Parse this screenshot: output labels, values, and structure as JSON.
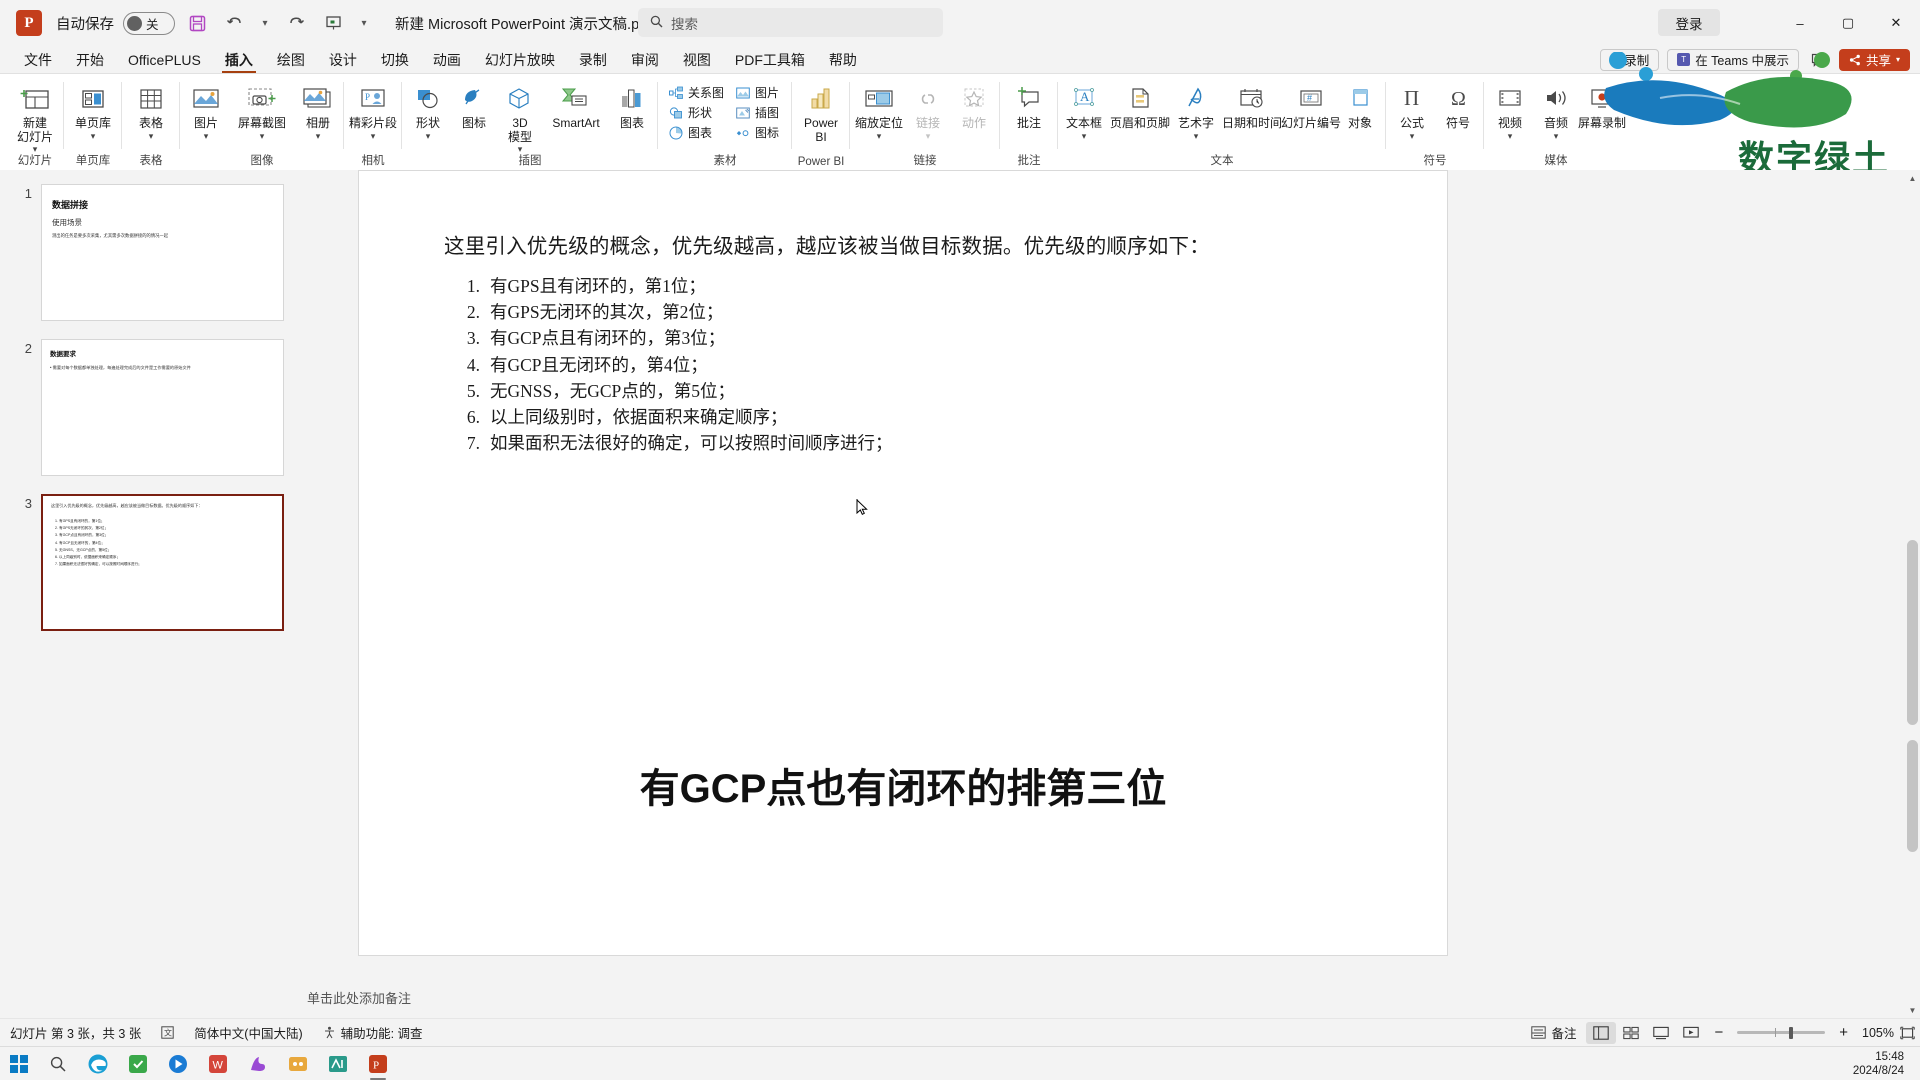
{
  "titlebar": {
    "app_icon": "powerpoint-icon",
    "autosave_label": "自动保存",
    "autosave_state": "关",
    "save_icon": "save-icon",
    "undo_icon": "undo-icon",
    "redo_icon": "redo-icon",
    "present_icon": "present-icon",
    "customize_icon": "customize-quick-access-icon",
    "doc_title": "新建 Microsoft PowerPoint 演示文稿.pptx",
    "search_placeholder": "搜索",
    "login_label": "登录",
    "minimize": "–",
    "maximize": "▢",
    "close": "✕"
  },
  "tabs": [
    {
      "label": "文件",
      "active": false
    },
    {
      "label": "开始",
      "active": false
    },
    {
      "label": "OfficePLUS",
      "active": false
    },
    {
      "label": "插入",
      "active": true
    },
    {
      "label": "绘图",
      "active": false
    },
    {
      "label": "设计",
      "active": false
    },
    {
      "label": "切换",
      "active": false
    },
    {
      "label": "动画",
      "active": false
    },
    {
      "label": "幻灯片放映",
      "active": false
    },
    {
      "label": "录制",
      "active": false
    },
    {
      "label": "审阅",
      "active": false
    },
    {
      "label": "视图",
      "active": false
    },
    {
      "label": "PDF工具箱",
      "active": false
    },
    {
      "label": "帮助",
      "active": false
    }
  ],
  "tab_right": {
    "record_label": "录制",
    "teams_label": "在 Teams 中展示",
    "comment_icon": "comment-icon",
    "share_label": "共享",
    "share_color": "#c43e1c"
  },
  "ribbon": {
    "groups": [
      {
        "label": "幻灯片",
        "buttons": [
          {
            "name": "new-slide",
            "label": "新建\n幻灯片",
            "caret": true,
            "icon": "new-slide-icon"
          }
        ]
      },
      {
        "label": "单页库",
        "buttons": [
          {
            "name": "page-library",
            "label": "单页库",
            "caret": true,
            "icon": "page-library-icon"
          }
        ]
      },
      {
        "label": "表格",
        "buttons": [
          {
            "name": "table",
            "label": "表格",
            "caret": true,
            "icon": "table-icon"
          }
        ]
      },
      {
        "label": "图像",
        "buttons": [
          {
            "name": "pictures",
            "label": "图片",
            "caret": true,
            "icon": "picture-icon"
          },
          {
            "name": "screenshot",
            "label": "屏幕截图",
            "caret": true,
            "icon": "screenshot-icon"
          },
          {
            "name": "photo-album",
            "label": "相册",
            "caret": true,
            "icon": "photo-album-icon"
          }
        ]
      },
      {
        "label": "相机",
        "buttons": [
          {
            "name": "highlight-clip",
            "label": "精彩片段",
            "caret": true,
            "icon": "highlight-clip-icon"
          }
        ]
      },
      {
        "label": "插图",
        "buttons": [
          {
            "name": "shapes",
            "label": "形状",
            "caret": true,
            "icon": "shapes-icon"
          },
          {
            "name": "icons",
            "label": "图标",
            "caret": false,
            "icon": "icons-icon"
          },
          {
            "name": "model-3d",
            "label": "3D 模型",
            "caret": true,
            "icon": "model-3d-icon"
          },
          {
            "name": "smartart",
            "label": "SmartArt",
            "caret": false,
            "icon": "smartart-icon"
          },
          {
            "name": "chart",
            "label": "图表",
            "caret": false,
            "icon": "chart-icon"
          }
        ]
      },
      {
        "label": "素材",
        "items": [
          {
            "name": "relation-chart",
            "label": "关系图",
            "icon": "relation-chart-icon"
          },
          {
            "name": "material-picture",
            "label": "图片",
            "icon": "material-picture-icon"
          },
          {
            "name": "material-shape",
            "label": "形状",
            "icon": "material-shape-icon"
          },
          {
            "name": "illustration",
            "label": "插图",
            "icon": "illustration-icon"
          },
          {
            "name": "material-chart",
            "label": "图表",
            "icon": "material-chart-icon"
          },
          {
            "name": "material-icon",
            "label": "图标",
            "icon": "material-icon-icon"
          }
        ]
      },
      {
        "label": "Power BI",
        "buttons": [
          {
            "name": "power-bi",
            "label": "Power\nBI",
            "caret": false,
            "icon": "power-bi-icon"
          }
        ]
      },
      {
        "label": "链接",
        "buttons": [
          {
            "name": "zoom-locate",
            "label": "缩放定位",
            "caret": true,
            "icon": "zoom-locate-icon"
          },
          {
            "name": "link",
            "label": "链接",
            "caret": true,
            "icon": "link-icon",
            "disabled": true
          },
          {
            "name": "action",
            "label": "动作",
            "caret": false,
            "icon": "action-icon",
            "disabled": true
          }
        ]
      },
      {
        "label": "批注",
        "buttons": [
          {
            "name": "new-comment",
            "label": "批注",
            "caret": false,
            "icon": "comment-plus-icon"
          }
        ]
      },
      {
        "label": "文本",
        "buttons": [
          {
            "name": "text-box",
            "label": "文本框",
            "caret": true,
            "icon": "text-box-icon"
          },
          {
            "name": "header-footer",
            "label": "页眉和页脚",
            "caret": false,
            "icon": "header-footer-icon"
          },
          {
            "name": "wordart",
            "label": "艺术字",
            "caret": true,
            "icon": "wordart-icon"
          },
          {
            "name": "date-time",
            "label": "日期和时间",
            "caret": false,
            "icon": "date-time-icon"
          },
          {
            "name": "slide-number",
            "label": "幻灯片编号",
            "caret": false,
            "icon": "slide-number-icon"
          },
          {
            "name": "object",
            "label": "对象",
            "caret": false,
            "icon": "object-icon"
          }
        ]
      },
      {
        "label": "符号",
        "buttons": [
          {
            "name": "equation",
            "label": "公式",
            "caret": true,
            "icon": "equation-icon"
          },
          {
            "name": "symbol",
            "label": "符号",
            "caret": false,
            "icon": "symbol-icon"
          }
        ]
      },
      {
        "label": "媒体",
        "buttons": [
          {
            "name": "video",
            "label": "视频",
            "caret": true,
            "icon": "video-icon"
          },
          {
            "name": "audio",
            "label": "音频",
            "caret": true,
            "icon": "audio-icon"
          },
          {
            "name": "screen-record",
            "label": "屏幕录制",
            "caret": false,
            "icon": "screen-record-icon"
          }
        ]
      }
    ]
  },
  "slide_panel": {
    "thumbs": [
      {
        "number": "1",
        "selected": false,
        "title": "数据拼接",
        "subtitle": "使用场景",
        "body": "测出的任务是要多次采集，尤其需多次数据拼接的的情况一起"
      },
      {
        "number": "2",
        "selected": false,
        "title": "数据要求",
        "subtitle": "",
        "body": "• 需要对每个数据都单独处理，每遍处理完成后的文件是工作需要的原始文件"
      },
      {
        "number": "3",
        "selected": true,
        "title": "",
        "subtitle": "",
        "body": "这里引入优先级的概念，优先级越高，越应该被当做目标数据。优先级的顺序如下："
      }
    ]
  },
  "slide": {
    "intro": "这里引入优先级的概念，优先级越高，越应该被当做目标数据。优先级的顺序如下：",
    "list": [
      {
        "num": "1.",
        "text": "有GPS且有闭环的，第1位；"
      },
      {
        "num": "2.",
        "text": "有GPS无闭环的其次，第2位；"
      },
      {
        "num": "3.",
        "text": "有GCP点且有闭环的，第3位；"
      },
      {
        "num": "4.",
        "text": "有GCP且无闭环的，第4位；"
      },
      {
        "num": "5.",
        "text": "无GNSS，无GCP点的，第5位；"
      },
      {
        "num": "6.",
        "text": "以上同级别时，依据面积来确定顺序；"
      },
      {
        "num": "7.",
        "text": "如果面积无法很好的确定，可以按照时间顺序进行；"
      }
    ],
    "caption": "有GCP点也有闭环的排第三位"
  },
  "notes": {
    "placeholder": "单击此处添加备注"
  },
  "statusbar": {
    "slide_count": "幻灯片 第 3 张，共 3 张",
    "accessibility_icon": "accessibility-icon",
    "language": "简体中文(中国大陆)",
    "accessibility_label": "辅助功能: 调查",
    "notes_label": "备注",
    "view_normal": "normal-view-icon",
    "view_sorter": "slide-sorter-icon",
    "view_reading": "reading-view-icon",
    "view_show": "slideshow-icon",
    "zoom_out": "−",
    "zoom_in": "+",
    "zoom_value": "105%",
    "fit_icon": "fit-slide-icon"
  },
  "taskbar": {
    "start_icon": "windows-start-icon",
    "search_icon": "taskbar-search-icon",
    "apps": [
      {
        "name": "edge-icon",
        "active": false
      },
      {
        "name": "app-green-icon",
        "active": false
      },
      {
        "name": "app-blue-play-icon",
        "active": false
      },
      {
        "name": "wps-icon",
        "active": false
      },
      {
        "name": "app-purple-icon",
        "active": false
      },
      {
        "name": "app-orange-icon",
        "active": false
      },
      {
        "name": "app-teal-icon",
        "active": false
      },
      {
        "name": "powerpoint-icon",
        "active": true
      }
    ],
    "time": "15:48",
    "date": "2024/8/24"
  },
  "watermark": {
    "text": "数字绿土",
    "color_green": "#3a9a4a",
    "color_blue": "#1a7bbd"
  }
}
